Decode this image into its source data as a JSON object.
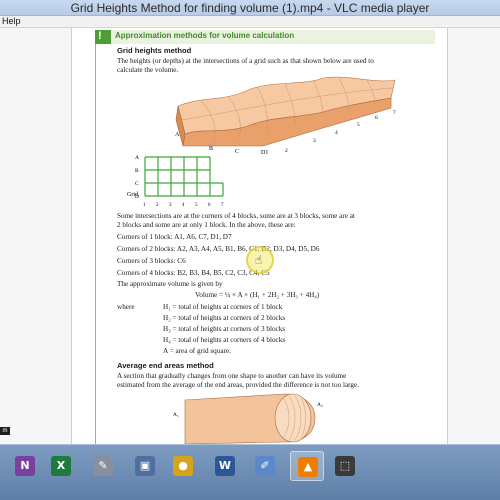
{
  "window": {
    "title": "Grid Heights Method for finding volume (1).mp4 - VLC media player",
    "menu_help": "Help",
    "edge_tag": "m"
  },
  "document": {
    "box_heading": "Approximation methods for volume calculation",
    "box_mark": "!",
    "section1_title": "Grid heights method",
    "intro_line1": "The heights (or depths) at the intersections of a grid such as that shown below are used to",
    "intro_line2": "calculate the volume.",
    "block_labels": {
      "A": "A",
      "B": "B",
      "C": "C",
      "D1": "D1"
    },
    "block_axis": [
      "1",
      "2",
      "3",
      "4",
      "5",
      "6",
      "7"
    ],
    "grid_label": "Grid",
    "grid_rows": [
      "A",
      "B",
      "C",
      "D"
    ],
    "grid_cols": [
      "1",
      "2",
      "3",
      "4",
      "5",
      "6",
      "7"
    ],
    "para_line1": "Some intersections are at the corners of 4 blocks, some are at 3 blocks, some are at",
    "para_line2": "2 blocks and some are at only 1 block. In the above, these are:",
    "corners1": "Corners of 1 block: A1, A6, C7, D1, D7",
    "corners2": "Corners of 2 blocks: A2, A3, A4, A5, B1, B6, C1, D2, D3, D4, D5, D6",
    "corners3": "Corners of 3 blocks: C6",
    "corners4": "Corners of 4 blocks: B2, B3, B4, B5, C2, C3, C4, C5",
    "approx_text": "The approximate volume is given by",
    "formula": "Volume = ¼ × A × (H₁ + 2H₂ + 3H₃ + 4H₄)",
    "where": "where",
    "def_h1": "H₁ = total of heights at corners of 1 block",
    "def_h2": "H₂ = total of heights at corners of 2 blocks",
    "def_h3": "H₃ = total of heights at corners of 3 blocks",
    "def_h4": "H₄ = total of heights at corners of 4 blocks",
    "def_a": "A  = area of grid square.",
    "section2_title": "Average end areas method",
    "end_line1": "A section that gradually changes from one shape to another can have its volume",
    "end_line2": "estimated from the average of the end areas, provided the difference is not too large.",
    "fig_a1": "A₁",
    "fig_a2": "A₂"
  },
  "taskbar": {
    "apps": [
      {
        "name": "onenote",
        "glyph": "N",
        "color": "#7b3fa0"
      },
      {
        "name": "excel",
        "glyph": "X",
        "color": "#1f7a3e"
      },
      {
        "name": "paint",
        "glyph": "✎",
        "color": "#8a8fa0"
      },
      {
        "name": "gallery",
        "glyph": "▣",
        "color": "#4f6fa0"
      },
      {
        "name": "chrome",
        "glyph": "●",
        "color": "#d9a21b"
      },
      {
        "name": "word",
        "glyph": "W",
        "color": "#2b5797"
      },
      {
        "name": "pen-tool",
        "glyph": "✐",
        "color": "#5a88c8"
      },
      {
        "name": "vlc",
        "glyph": "▲",
        "color": "#ef7d00"
      },
      {
        "name": "snipping",
        "glyph": "⬚",
        "color": "#3a3a3a"
      }
    ]
  },
  "colors": {
    "accent_green": "#4f9e35",
    "block_orange": "#f2b486",
    "grid_green": "#3aa63a"
  }
}
